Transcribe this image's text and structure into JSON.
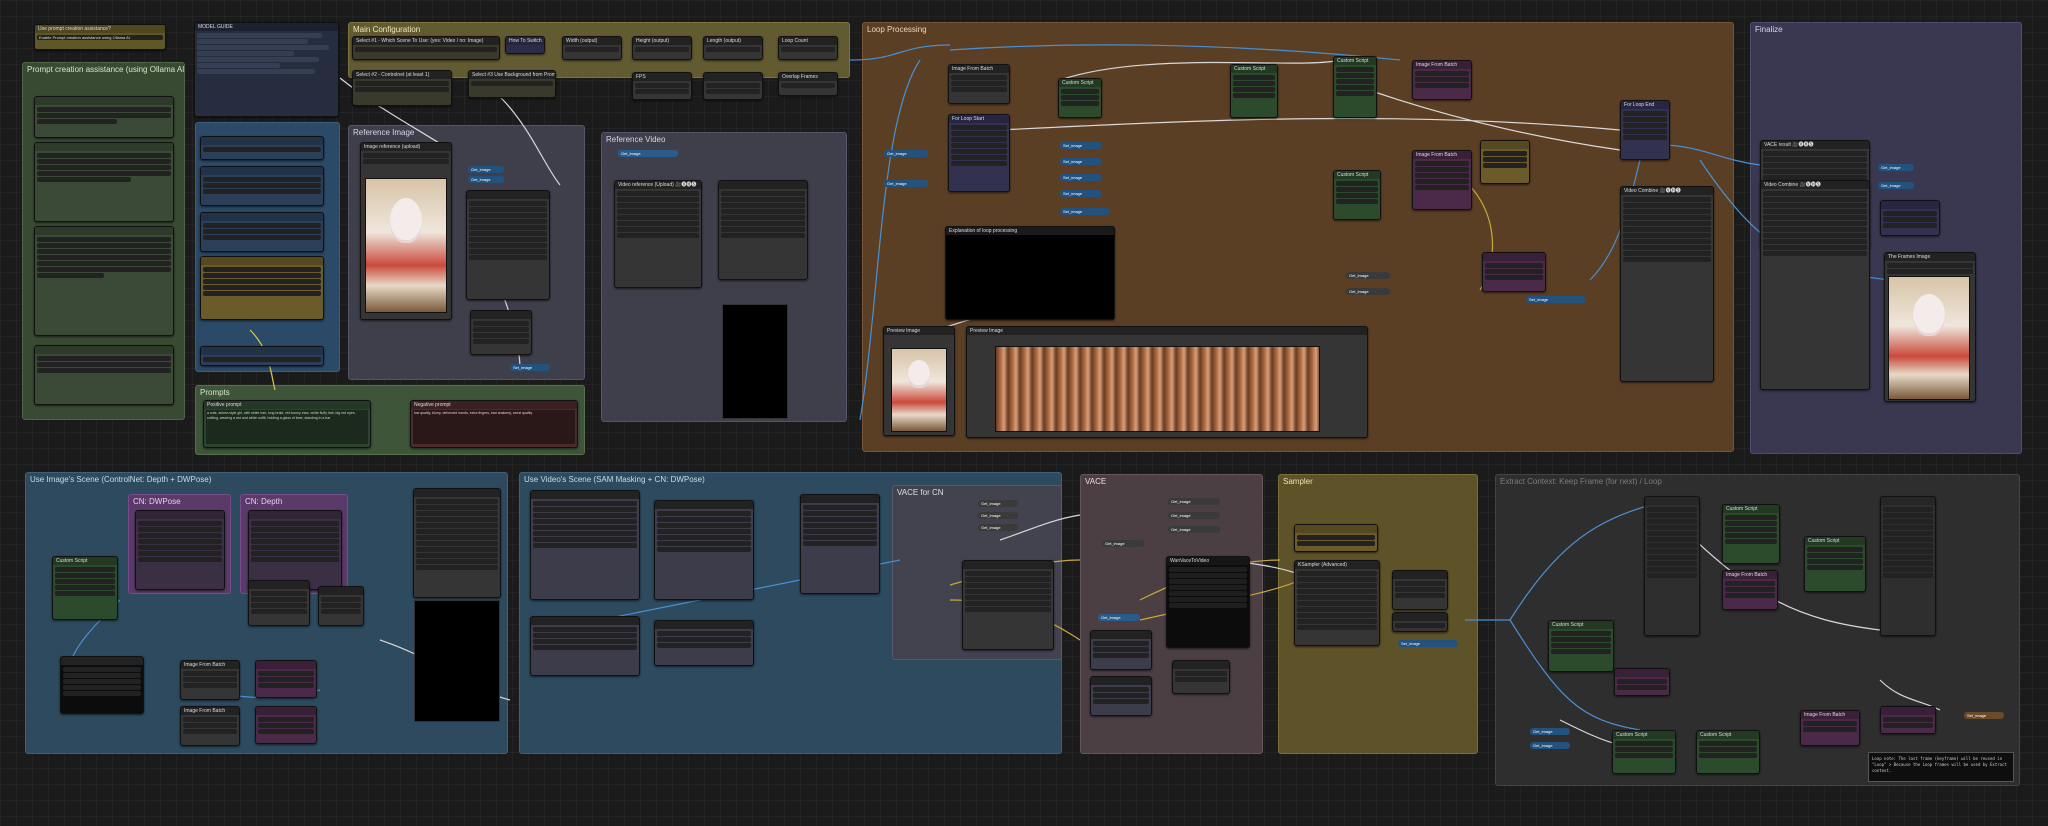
{
  "groups": {
    "prompt_creation": "Prompt creation assistance (using Ollama AI)",
    "main_configuration": "Main Configuration",
    "loop_processing": "Loop Processing",
    "finalize": "Finalize",
    "reference_image": "Reference Image",
    "reference_video": "Reference Video",
    "prompts": "Prompts",
    "use_images_scene": "Use Image's Scene (ControlNet: Depth + DWPose)",
    "use_videos_scene": "Use Video's Scene (SAM Masking + CN: DWPose)",
    "vace_for_cn": "VACE for CN",
    "vace": "VACE",
    "sampler": "Sampler",
    "cn_dwpose": "CN: DWPose",
    "cn_depth": "CN: Depth",
    "extract_last": "Extract Context: Keep Frame (for next) / Loop"
  },
  "nodes": {
    "use_prompt_creation": "Use prompt creation assistance?",
    "model_guide": "MODEL GUIDE",
    "select_1": "Select #1 - Which Scene To Use: (yes: Video / no: Image)",
    "select_2": "Select #2 - Controlnet (at least 1)",
    "select_3": "Select #3 Use Background from Prompt",
    "how_to_switch": "How To Switch",
    "width_output": "Width (output)",
    "height_output": "Height (output)",
    "length_output": "Length (output)",
    "loop_count": "Loop Count",
    "fps": "FPS",
    "overlap_frames": "Overlap Frames",
    "image_reference_upload": "Image reference (upload)",
    "video_reference_upload": "Video reference (Upload) 🎥🅥🅗🅢",
    "loop_start": "For Loop Start",
    "loop_end": "For Loop End",
    "explanation": "Explanation of loop processing",
    "preview_image": "Preview Image",
    "vace_result": "VACE result 🎥🅥🅗🅢",
    "final_video_combine": "Video Combine 🎥🅥🅗🅢",
    "the_frames_image": "The Frames Image",
    "positive_prompt": "Positive prompt",
    "negative_prompt": "Negative prompt",
    "ksampler": "KSampler (Advanced)",
    "wan_vace_to_video": "WanVaceToVideo",
    "custom_script": "Custom Script",
    "image_from_batch": "Image From Batch",
    "get_node": "Get_image",
    "set_node": "Set_image"
  },
  "notes": {
    "prompt_note": "Enable Prompt creation assistance using Ollama AI",
    "positive_text": "a cute, anime-style girl, with white hair, long braid, red bunny ears, white fluffy hair, big red eyes, smiling, wearing a red and white outfit, holding a glass of beer, standing in a bar",
    "negative_text": "low quality, blurry, deformed hands, extra fingers, bad anatomy, worst quality",
    "bottom_note": "Loop note: The last frame (keyframe) will be reused in \"Loop\" > Because the Loop frames will be used by Extract context."
  },
  "colors": {
    "group_main": "#6b6335",
    "group_loop": "#6f4e2a",
    "group_final": "#3c3a55",
    "group_cn": "#3a5a6a",
    "link_blue": "#4a8fd3",
    "link_white": "#d9d9d9",
    "link_yellow": "#c7a83a"
  },
  "icons": {
    "thumbnails": "anime-girl-thumbnail",
    "filmstrip": "frames-filmstrip"
  }
}
